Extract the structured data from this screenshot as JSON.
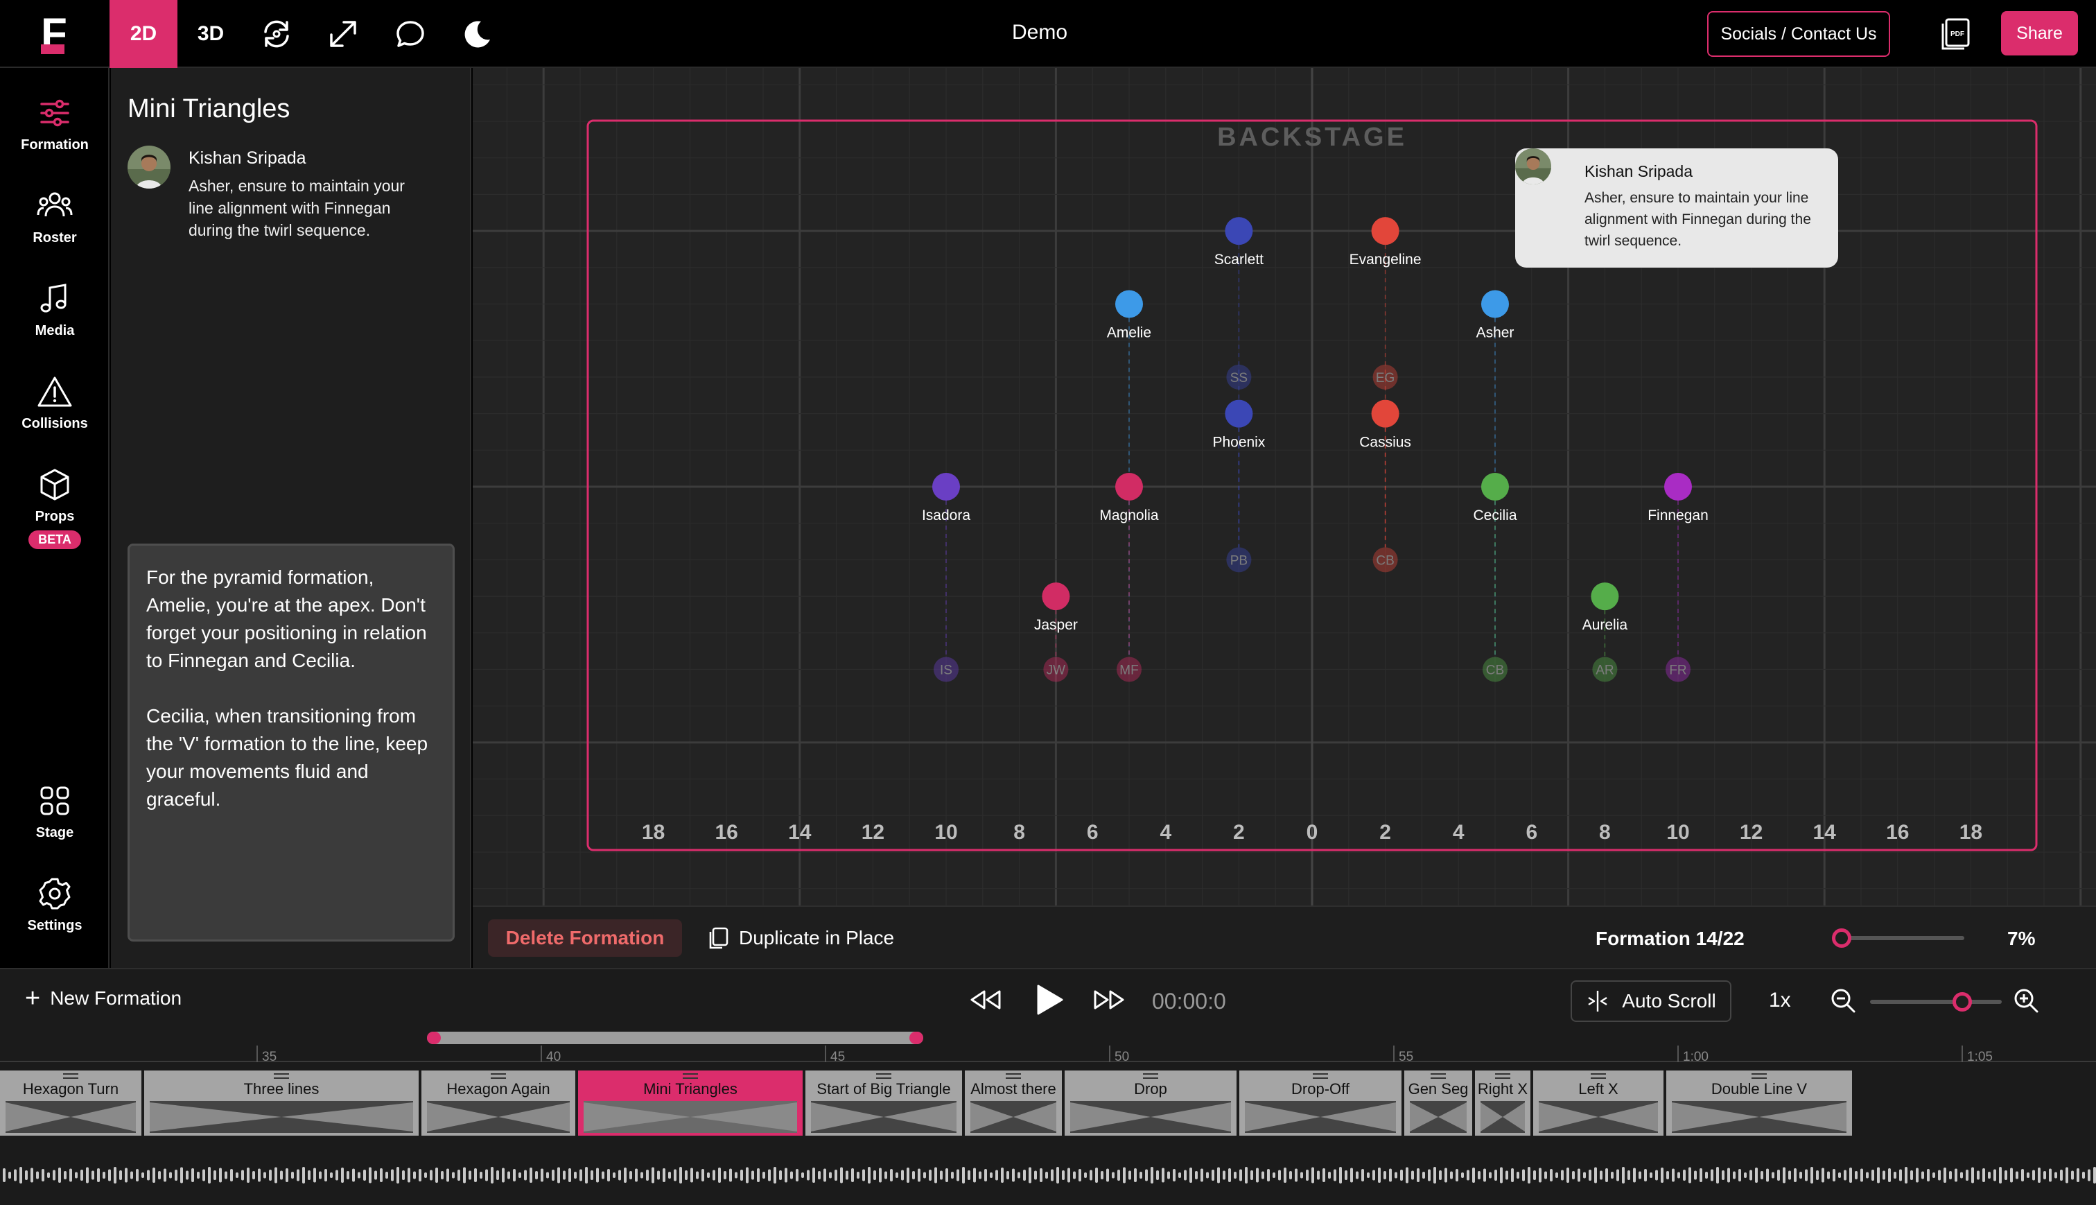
{
  "app": {
    "title": "Demo",
    "view_2d": "2D",
    "view_3d": "3D",
    "socials_label": "Socials / Contact Us",
    "share_label": "Share",
    "pdf_label": "PDF"
  },
  "rail": {
    "formation": "Formation",
    "roster": "Roster",
    "media": "Media",
    "collisions": "Collisions",
    "props": "Props",
    "beta": "BETA",
    "stage": "Stage",
    "settings": "Settings"
  },
  "panel": {
    "formation_name": "Mini Triangles",
    "comment": {
      "author": "Kishan Sripada",
      "text": "Asher, ensure to maintain your line alignment with Finnegan during the twirl sequence."
    },
    "notes": "For the pyramid formation, Amelie, you're at the apex. Don't forget your positioning in relation to Finnegan and Cecilia.\n\nCecilia, when transitioning from the 'V' formation to the line, keep your movements fluid and graceful."
  },
  "stage": {
    "backstage_label": "BACKSTAGE",
    "axis_labels": [
      "18",
      "16",
      "14",
      "12",
      "10",
      "8",
      "6",
      "4",
      "2",
      "0",
      "2",
      "4",
      "6",
      "8",
      "10",
      "12",
      "14",
      "16",
      "18"
    ],
    "dancers": [
      {
        "name": "Scarlett",
        "x": -2,
        "y": 7,
        "color": "#3b47b5"
      },
      {
        "name": "Evangeline",
        "x": 2,
        "y": 7,
        "color": "#e2463a"
      },
      {
        "name": "Amelie",
        "x": -5,
        "y": 5,
        "color": "#3d9ae8"
      },
      {
        "name": "Asher",
        "x": 5,
        "y": 5,
        "color": "#3d9ae8"
      },
      {
        "name": "Phoenix",
        "x": -2,
        "y": 2,
        "color": "#3b47b5"
      },
      {
        "name": "Cassius",
        "x": 2,
        "y": 2,
        "color": "#e2463a"
      },
      {
        "name": "Isadora",
        "x": -10,
        "y": 0,
        "color": "#6a3fc4"
      },
      {
        "name": "Magnolia",
        "x": -5,
        "y": 0,
        "color": "#d12c64"
      },
      {
        "name": "Cecilia",
        "x": 5,
        "y": 0,
        "color": "#55ad4a"
      },
      {
        "name": "Finnegan",
        "x": 10,
        "y": 0,
        "color": "#a92cc4"
      },
      {
        "name": "Jasper",
        "x": -7,
        "y": -3,
        "color": "#d12c64"
      },
      {
        "name": "Aurelia",
        "x": 8,
        "y": -3,
        "color": "#55ad4a"
      }
    ],
    "ghosts": [
      {
        "initials": "SS",
        "x": -2,
        "y": 3,
        "color": "#3b47b5"
      },
      {
        "initials": "EG",
        "x": 2,
        "y": 3,
        "color": "#e2463a"
      },
      {
        "initials": "PB",
        "x": -2,
        "y": -2,
        "color": "#3b47b5"
      },
      {
        "initials": "CB",
        "x": 2,
        "y": -2,
        "color": "#e2463a"
      },
      {
        "initials": "IS",
        "x": -10,
        "y": -5,
        "color": "#6a3fc4"
      },
      {
        "initials": "JW",
        "x": -7,
        "y": -5,
        "color": "#d12c64"
      },
      {
        "initials": "MF",
        "x": -5,
        "y": -5,
        "color": "#d12c64"
      },
      {
        "initials": "CB",
        "x": 5,
        "y": -5,
        "color": "#55ad4a"
      },
      {
        "initials": "AR",
        "x": 8,
        "y": -5,
        "color": "#55ad4a"
      },
      {
        "initials": "FR",
        "x": 10,
        "y": -5,
        "color": "#a92cc4"
      }
    ],
    "comment_card": {
      "author": "Kishan Sripada",
      "text": "Asher, ensure to maintain your line alignment with Finnegan during the twirl sequence."
    }
  },
  "actionbar": {
    "delete_label": "Delete Formation",
    "duplicate_label": "Duplicate in Place",
    "formation_counter": "Formation 14/22",
    "zoom_percent": "7%",
    "zoom_value": 0.07
  },
  "playback": {
    "new_formation_label": "New Formation",
    "time": "00:00:0",
    "autoscroll_label": "Auto Scroll",
    "speed": "1x",
    "zoom_level": 0.7
  },
  "timeline": {
    "ruler": [
      "35",
      "40",
      "45",
      "50",
      "55",
      "1:00",
      "1:05"
    ],
    "segments": [
      {
        "name": "Hexagon Turn",
        "active": false
      },
      {
        "name": "Three lines",
        "active": false
      },
      {
        "name": "Hexagon Again",
        "active": false
      },
      {
        "name": "Mini Triangles",
        "active": true
      },
      {
        "name": "Start of Big Triangle",
        "active": false
      },
      {
        "name": "Almost there",
        "active": false
      },
      {
        "name": "Drop",
        "active": false
      },
      {
        "name": "Drop-Off",
        "active": false
      },
      {
        "name": "Gen Seg",
        "active": false
      },
      {
        "name": "Right X",
        "active": false
      },
      {
        "name": "Left X",
        "active": false
      },
      {
        "name": "Double Line V",
        "active": false
      }
    ]
  },
  "colors": {
    "accent": "#db2d6c",
    "stage_bg": "#232323",
    "panel_bg": "#1e1e1e"
  },
  "icons": [
    "sliders-icon",
    "users-icon",
    "music-icon",
    "warning-icon",
    "cube-icon",
    "grid-icon",
    "gear-icon",
    "rotate-icon",
    "expand-icon",
    "chat-icon",
    "moon-icon",
    "pdf-icon",
    "rewind-icon",
    "play-icon",
    "fast-forward-icon",
    "zoom-out-icon",
    "zoom-in-icon",
    "copy-icon",
    "plus-icon",
    "autoscroll-icon"
  ]
}
